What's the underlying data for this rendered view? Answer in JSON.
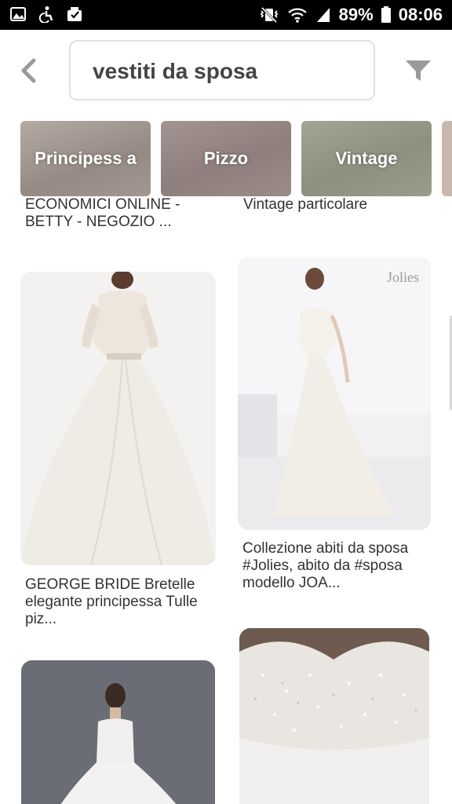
{
  "status_bar": {
    "battery": "89%",
    "time": "08:06"
  },
  "header": {
    "back_icon": "chevron-left-icon",
    "search_value": "vestiti da sposa",
    "filter_icon": "filter-icon"
  },
  "chips": [
    {
      "label": "Principess a"
    },
    {
      "label": "Pizzo"
    },
    {
      "label": "Vintage"
    }
  ],
  "feed": {
    "top_left_caption": "ECONOMICI ONLINE - BETTY - NEGOZIO ...",
    "top_right_caption": "Vintage particolare",
    "pins": [
      {
        "caption": "GEORGE BRIDE Bretelle elegante principessa Tulle piz..."
      },
      {
        "caption": "Collezione abiti da sposa #Jolies, abito da #sposa modello JOA...",
        "watermark": "Jolies"
      },
      {
        "caption": ""
      },
      {
        "caption": ""
      }
    ]
  },
  "colors": {
    "header_bg": "#ffffff",
    "icon_gray": "#9a9a9a",
    "text_dark": "#333333"
  }
}
